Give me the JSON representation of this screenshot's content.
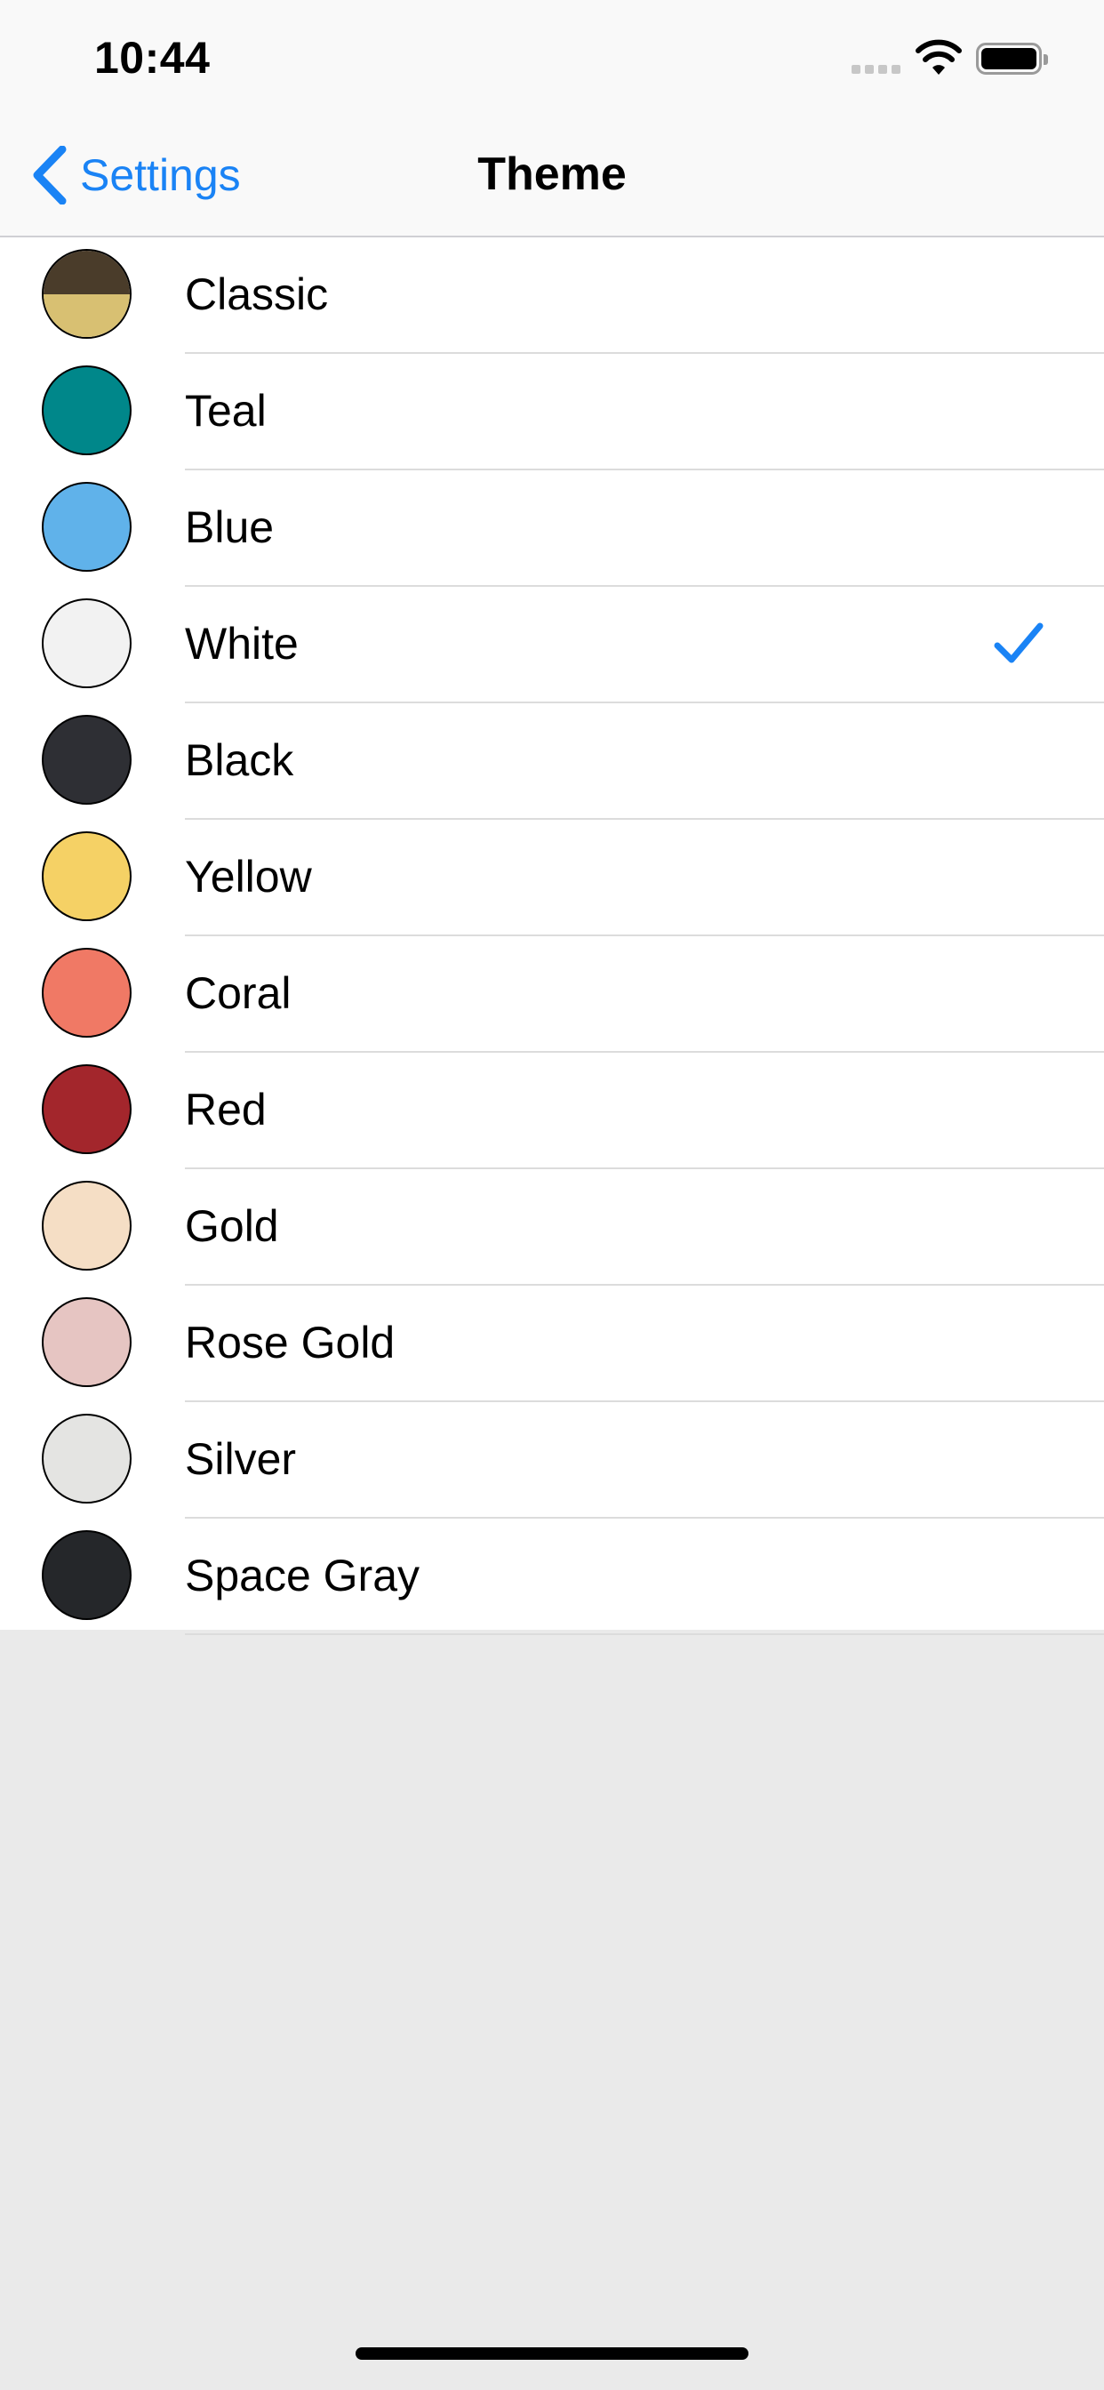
{
  "status_bar": {
    "time": "10:44"
  },
  "nav": {
    "back_label": "Settings",
    "title": "Theme"
  },
  "colors": {
    "accent": "#1a83f5"
  },
  "themes": [
    {
      "label": "Classic",
      "color": "#d8c072",
      "color_top": "#4a3c2a",
      "selected": false
    },
    {
      "label": "Teal",
      "color": "#00878a",
      "selected": false
    },
    {
      "label": "Blue",
      "color": "#60b2ea",
      "selected": false
    },
    {
      "label": "White",
      "color": "#f2f2f2",
      "selected": true
    },
    {
      "label": "Black",
      "color": "#2e2f34",
      "selected": false
    },
    {
      "label": "Yellow",
      "color": "#f5d165",
      "selected": false
    },
    {
      "label": "Coral",
      "color": "#f07965",
      "selected": false
    },
    {
      "label": "Red",
      "color": "#a3262c",
      "selected": false
    },
    {
      "label": "Gold",
      "color": "#f5dec5",
      "selected": false
    },
    {
      "label": "Rose Gold",
      "color": "#e6c5c2",
      "selected": false
    },
    {
      "label": "Silver",
      "color": "#e4e4e2",
      "selected": false
    },
    {
      "label": "Space Gray",
      "color": "#25272a",
      "selected": false
    }
  ]
}
